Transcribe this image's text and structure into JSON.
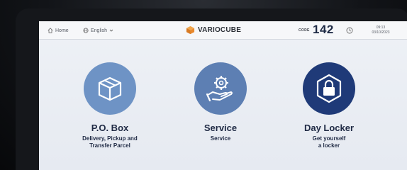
{
  "header": {
    "home_label": "Home",
    "language_label": "English",
    "brand_name": "VARIOCUBE",
    "code_label": "CODE",
    "code_value": "142",
    "time": "09:13",
    "date": "03/10/2023"
  },
  "tiles": [
    {
      "title": "P.O. Box",
      "subtitle_line1": "Delivery, Pickup and",
      "subtitle_line2": "Transfer Parcel",
      "icon": "box-icon"
    },
    {
      "title": "Service",
      "subtitle_line1": "Service",
      "subtitle_line2": "",
      "icon": "service-hand-gear-icon"
    },
    {
      "title": "Day Locker",
      "subtitle_line1": "Get yourself",
      "subtitle_line2": "a locker",
      "icon": "lock-icon"
    }
  ],
  "colors": {
    "tile1": "#6e93c5",
    "tile2": "#5d7fb3",
    "tile3": "#1f3a78",
    "brand_orange": "#e8892e",
    "text_dark": "#1f2a44"
  }
}
